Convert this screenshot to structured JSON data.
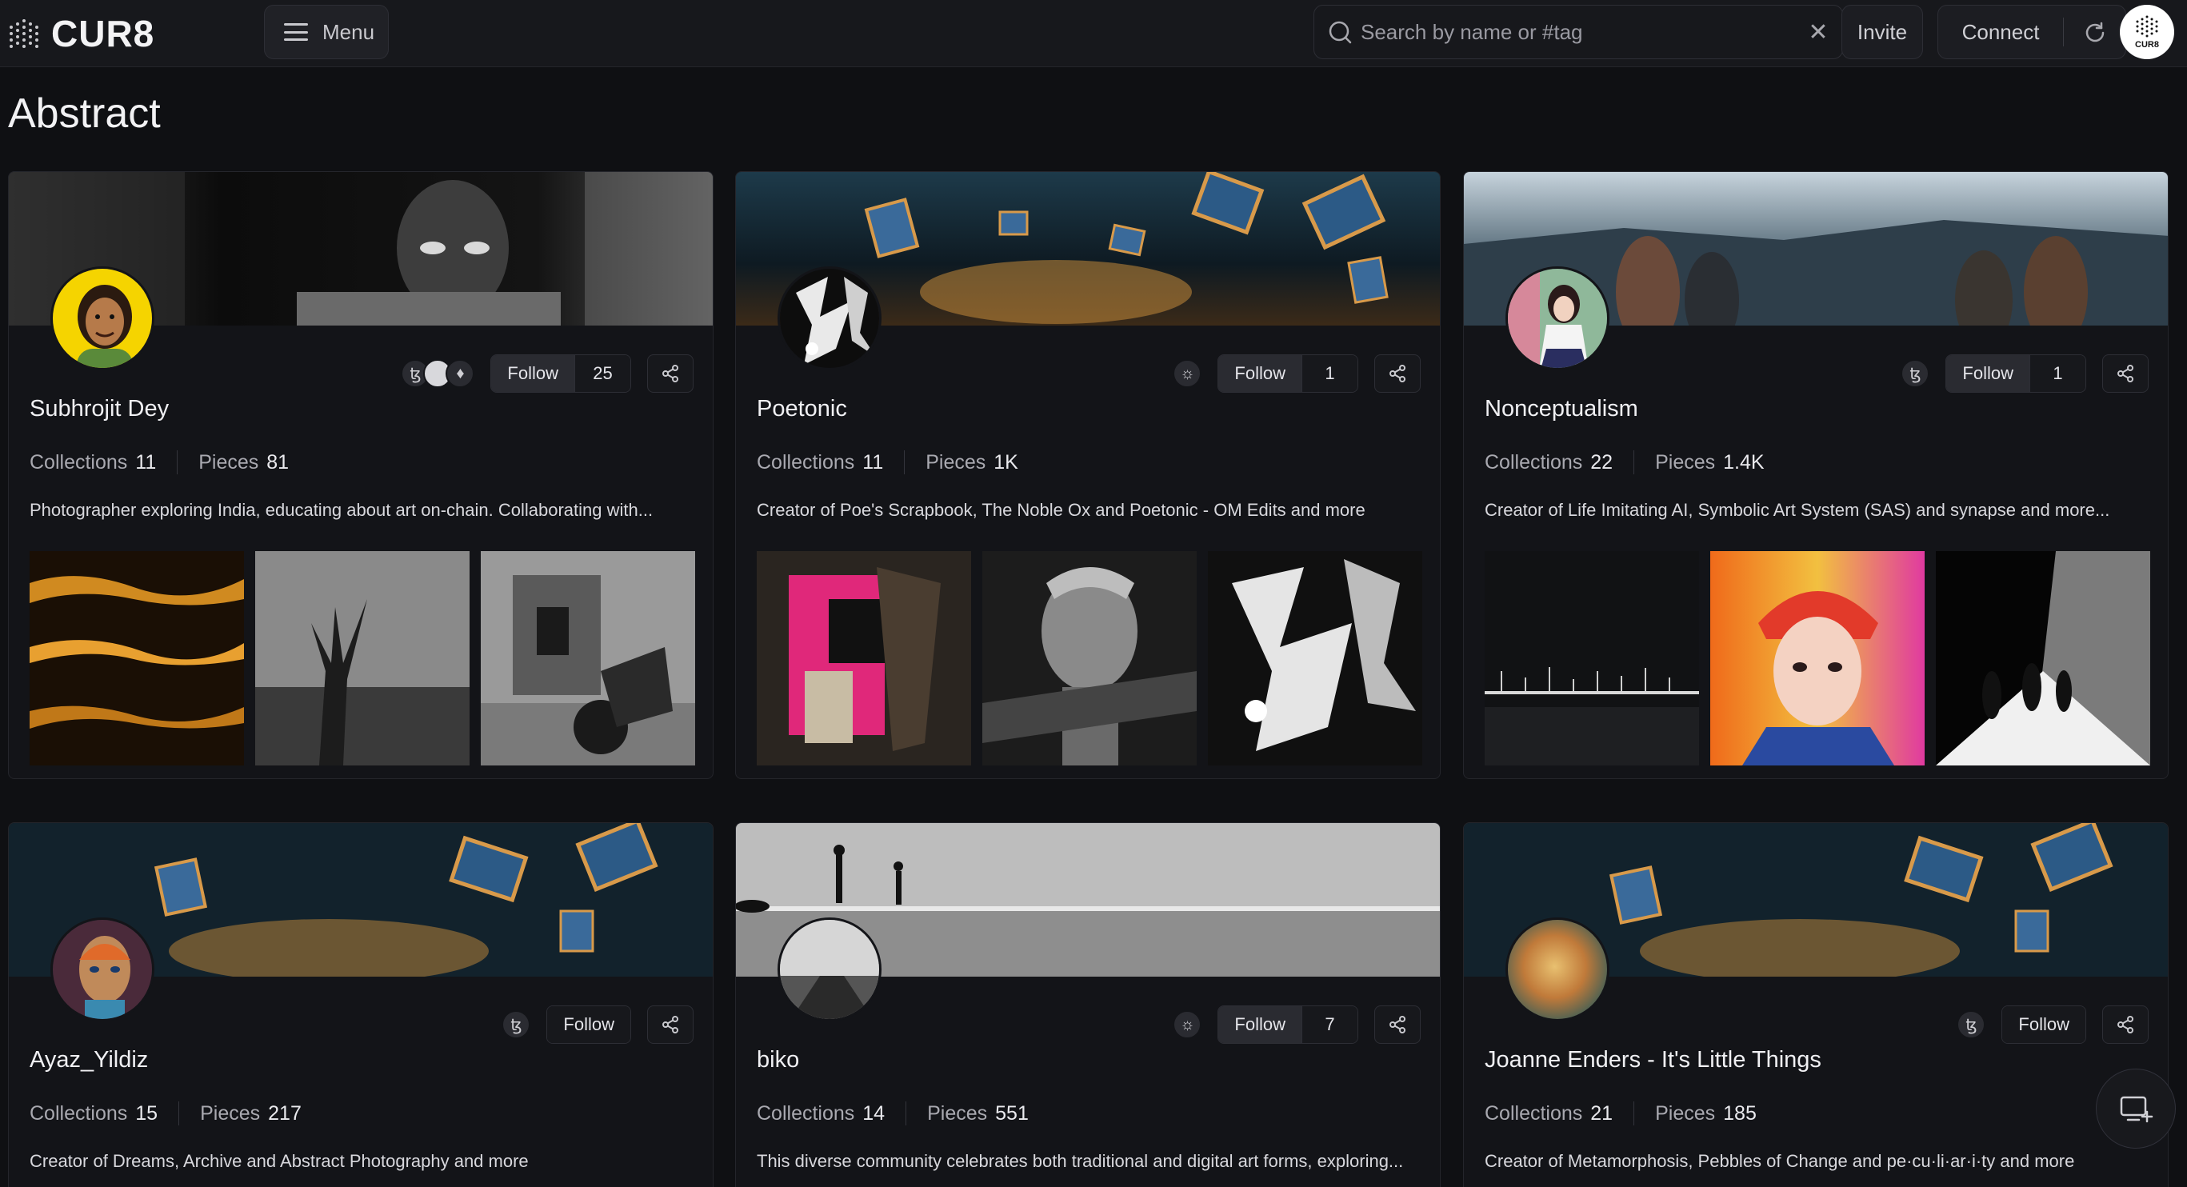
{
  "header": {
    "logo_text": "CUR8",
    "menu_label": "Menu",
    "search_placeholder": "Search by name or #tag",
    "search_value": "",
    "clear_glyph": "✕",
    "invite_label": "Invite",
    "connect_label": "Connect",
    "avatar_text": "CUR8"
  },
  "page": {
    "title": "Abstract"
  },
  "cards": [
    {
      "name": "Subhrojit Dey",
      "collections_label": "Collections",
      "collections": "11",
      "pieces_label": "Pieces",
      "pieces": "81",
      "follow_label": "Follow",
      "followers": "25",
      "chains": [
        "tezos-icon",
        "moon-icon",
        "ethereum-icon"
      ],
      "description": "Photographer exploring India, educating about art on-chain. Collaborating with..."
    },
    {
      "name": "Poetonic",
      "collections_label": "Collections",
      "collections": "11",
      "pieces_label": "Pieces",
      "pieces": "1K",
      "follow_label": "Follow",
      "followers": "1",
      "chains": [
        "sun-icon"
      ],
      "description": "Creator of Poe's Scrapbook, The Noble Ox and Poetonic - OM Edits and more"
    },
    {
      "name": "Nonceptualism",
      "collections_label": "Collections",
      "collections": "22",
      "pieces_label": "Pieces",
      "pieces": "1.4K",
      "follow_label": "Follow",
      "followers": "1",
      "chains": [
        "tezos-icon"
      ],
      "description": "Creator of Life Imitating AI, Symbolic Art System (SAS) and synapse and more..."
    },
    {
      "name": "Ayaz_Yildiz",
      "collections_label": "Collections",
      "collections": "15",
      "pieces_label": "Pieces",
      "pieces": "217",
      "follow_label": "Follow",
      "followers": "",
      "chains": [
        "tezos-icon"
      ],
      "description": "Creator of Dreams, Archive and Abstract Photography and more"
    },
    {
      "name": "biko",
      "collections_label": "Collections",
      "collections": "14",
      "pieces_label": "Pieces",
      "pieces": "551",
      "follow_label": "Follow",
      "followers": "7",
      "chains": [
        "sun-icon"
      ],
      "description": "This diverse community celebrates both traditional and digital art forms, exploring..."
    },
    {
      "name": "Joanne Enders - It's Little Things",
      "collections_label": "Collections",
      "collections": "21",
      "pieces_label": "Pieces",
      "pieces": "185",
      "follow_label": "Follow",
      "followers": "",
      "chains": [
        "tezos-icon"
      ],
      "description": "Creator of Metamorphosis, Pebbles of Change and pe·cu·li·ar·i·ty and more"
    }
  ],
  "glyphs": {
    "tezos": "ꜩ",
    "sun": "☼",
    "ethereum": "♦"
  },
  "colors": {
    "background": "#0f1013",
    "card": "#131418",
    "header": "#17181c",
    "accent_gold": "#f5d400"
  }
}
